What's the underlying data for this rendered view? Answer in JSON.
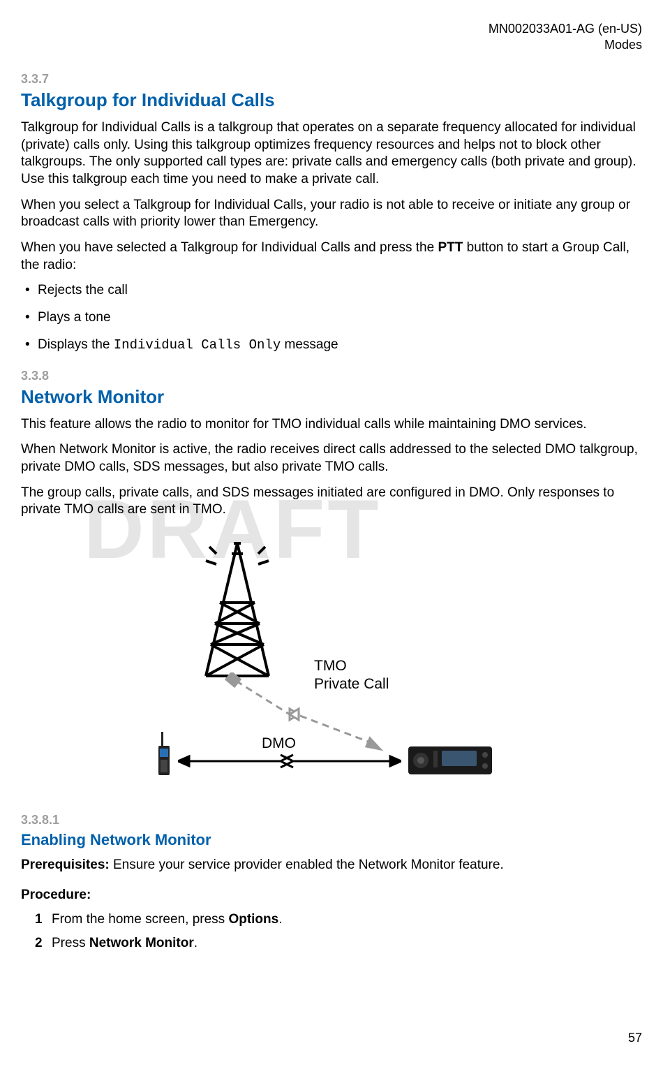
{
  "header": {
    "doc_id": "MN002033A01-AG (en-US)",
    "chapter": "Modes"
  },
  "watermark": "DRAFT",
  "section337": {
    "num": "3.3.7",
    "title": "Talkgroup for Individual Calls",
    "para1": "Talkgroup for Individual Calls is a talkgroup that operates on a separate frequency allocated for individual (private) calls only. Using this talkgroup optimizes frequency resources and helps not to block other talkgroups. The only supported call types are: private calls and emergency calls (both private and group). Use this talkgroup each time you need to make a private call.",
    "para2": "When you select a Talkgroup for Individual Calls, your radio is not able to receive or initiate any group or broadcast calls with priority lower than Emergency.",
    "para3_pre": "When you have selected a Talkgroup for Individual Calls and press the ",
    "para3_bold": "PTT",
    "para3_post": " button to start a Group Call, the radio:",
    "bullets": {
      "b1": "Rejects the call",
      "b2": "Plays a tone",
      "b3_pre": "Displays the ",
      "b3_mono": "Individual Calls Only",
      "b3_post": " message"
    }
  },
  "section338": {
    "num": "3.3.8",
    "title": "Network Monitor",
    "para1": "This feature allows the radio to monitor for TMO individual calls while maintaining DMO services.",
    "para2": "When Network Monitor is active, the radio receives direct calls addressed to the selected DMO talkgroup, private DMO calls, SDS messages, but also private TMO calls.",
    "para3": "The group calls, private calls, and SDS messages initiated are configured in DMO. Only responses to private TMO calls are sent in TMO."
  },
  "diagram": {
    "label_tmo_line1": "TMO",
    "label_tmo_line2": "Private Call",
    "label_dmo": "DMO"
  },
  "section3381": {
    "num": "3.3.8.1",
    "title": "Enabling Network Monitor",
    "prereq_label": "Prerequisites:",
    "prereq_text": " Ensure your service provider enabled the Network Monitor feature.",
    "procedure_label": "Procedure:",
    "step1_pre": "From the home screen, press ",
    "step1_bold": "Options",
    "step1_post": ".",
    "step2_pre": "Press ",
    "step2_bold": "Network Monitor",
    "step2_post": "."
  },
  "page_number": "57"
}
